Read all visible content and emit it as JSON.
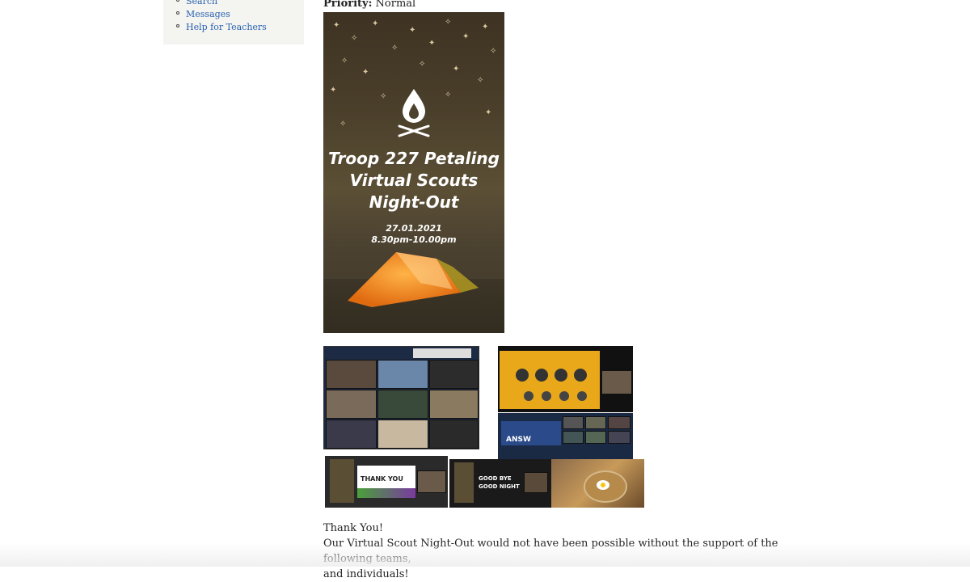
{
  "sidebar": {
    "items": [
      {
        "label": "Search"
      },
      {
        "label": "Messages"
      },
      {
        "label": "Help for Teachers"
      }
    ]
  },
  "article": {
    "priority_label": "Priority:",
    "priority_value": "Normal",
    "poster": {
      "title_line1": "Troop 227 Petaling",
      "title_line2": "Virtual Scouts",
      "title_line3": "Night-Out",
      "date": "27.01.2021",
      "time": "8.30pm-10.00pm"
    },
    "collage": {
      "thank_you": "THANK YOU",
      "goodbye_line1": "GOOD BYE",
      "goodbye_line2": "GOOD NIGHT",
      "answer": "ANSW",
      "poster_mini": "Troop 227 Petaling Virtual Scouts Night-Out"
    },
    "body_line1": "Thank You!",
    "body_line2": "Our Virtual Scout Night-Out would not have been possible without the support of the following teams,",
    "body_line3": "and individuals!"
  }
}
